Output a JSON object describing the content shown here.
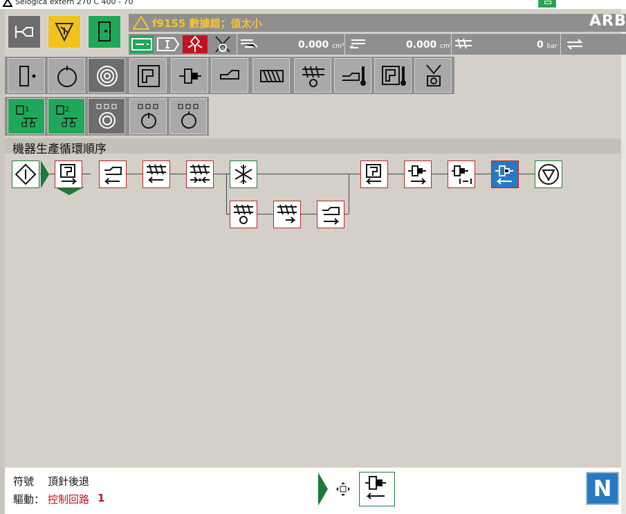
{
  "window": {
    "title": "Selogica extern 270 C 400 - 70"
  },
  "header": {
    "alarm_text": "f9155 數據錯；值太小",
    "logo_text": "ARB"
  },
  "status": {
    "volume1": "0.000",
    "volume1_unit": "cm³",
    "volume2": "0.000",
    "volume2_unit": "cm³",
    "pressure": "0",
    "pressure_unit": "bar"
  },
  "section": {
    "title": "機器生產循環順序"
  },
  "footer": {
    "symbol_label": "符號",
    "symbol_value": "頂針後退",
    "drive_label": "驅動：",
    "drive_value": "控制回路",
    "drive_number": "1",
    "n_button": "N"
  },
  "colors": {
    "panel_grey": "#8f8f8f",
    "button_grey": "#a9a9a9",
    "selected_grey": "#6d6d6d",
    "green": "#1fa85a",
    "yellow": "#f0c31c",
    "alarm_yellow": "#f4c430",
    "active_blue": "#2b78c2",
    "node_border_red": "#b22222"
  },
  "icons": {
    "main_buttons": [
      "mold-operation-icon",
      "alarm-icon",
      "cycle-start-icon"
    ],
    "toolbar": [
      "single-cycle-icon",
      "cycle-icon",
      "auto-cycle-icon",
      "mold-icon",
      "ejector-icon",
      "injection-unit-icon",
      "screw-icon",
      "plasticizing-icon",
      "nozzle-temperature-icon",
      "mold-temperature-icon",
      "robot-icon"
    ],
    "sequence_toolbar": [
      "sequence-1-icon",
      "sequence-2-icon",
      "sequence-cycle-icon",
      "sequence-power-icon",
      "sequence-start-icon"
    ]
  }
}
